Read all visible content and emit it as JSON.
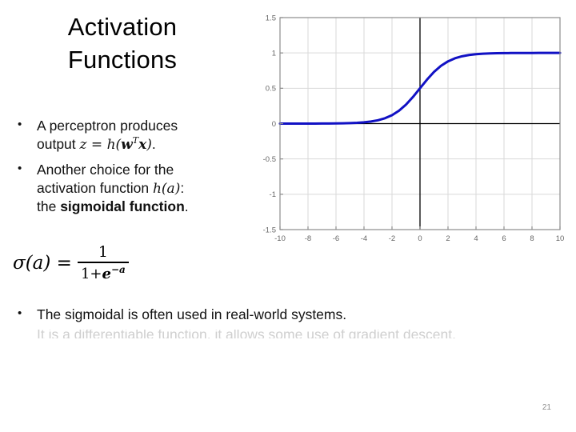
{
  "slide": {
    "title": "Activation\nFunctions",
    "page_number": "21",
    "bullet_glyph": "•"
  },
  "bullets": [
    {
      "line1_prefix": " A perceptron produces",
      "line2_prefix": "output ",
      "math_z": "z",
      "math_eq": " = ",
      "math_h": "h",
      "math_open": "(",
      "math_w": "w",
      "math_sup_T": "T",
      "math_x": "x",
      "math_close": ")",
      "tail": "."
    },
    {
      "line1": "Another choice for the",
      "line2_prefix": "activation function ",
      "math_h": "h",
      "math_open": "(",
      "math_a": "a",
      "math_close": ")",
      "line2_tail": ":",
      "line3_prefix": "the ",
      "line3_bold": "sigmoidal function",
      "line3_tail": "."
    }
  ],
  "equation": {
    "lhs": "σ(a) =",
    "numerator": "1",
    "denominator_one": "1+",
    "denominator_e": "e",
    "denominator_exp": "−a"
  },
  "bottom_bullets": [
    {
      "text": "The sigmoidal is often used in real-world systems."
    }
  ],
  "clipped_line": {
    "text": "It is a differentiable function, it allows some use of gradient descent."
  },
  "chart_data": {
    "type": "line",
    "title": "",
    "xlabel": "",
    "ylabel": "",
    "xlim": [
      -10,
      10
    ],
    "ylim": [
      -1.5,
      1.5
    ],
    "grid": true,
    "legend": null,
    "x_ticks": [
      "-10",
      "-8",
      "-6",
      "-4",
      "-2",
      "0",
      "2",
      "4",
      "6",
      "8",
      "10"
    ],
    "y_ticks": [
      "1.5",
      "1",
      "0.5",
      "0",
      "-0.5",
      "-1",
      "-1.5"
    ],
    "x_tick_values": [
      -10,
      -8,
      -6,
      -4,
      -2,
      0,
      2,
      4,
      6,
      8,
      10
    ],
    "y_tick_values": [
      1.5,
      1,
      0.5,
      0,
      -0.5,
      -1,
      -1.5
    ],
    "zero_axis_color": "#000000",
    "grid_color": "#d9d9d9",
    "frame_color": "#8c8c8c",
    "tick_label_color": "#666666",
    "series": [
      {
        "name": "sigmoid",
        "color": "#1111c4",
        "linewidth": 3,
        "x": [
          -10,
          -9.5,
          -9,
          -8.5,
          -8,
          -7.5,
          -7,
          -6.5,
          -6,
          -5.5,
          -5,
          -4.5,
          -4,
          -3.5,
          -3,
          -2.5,
          -2,
          -1.5,
          -1,
          -0.5,
          0,
          0.5,
          1,
          1.5,
          2,
          2.5,
          3,
          3.5,
          4,
          4.5,
          5,
          5.5,
          6,
          6.5,
          7,
          7.5,
          8,
          8.5,
          9,
          9.5,
          10
        ],
        "y": [
          4.54e-05,
          7.49e-05,
          0.0001234,
          0.0002035,
          0.0003354,
          0.0005527,
          0.000911,
          0.0015011,
          0.0024726,
          0.0040701,
          0.0066929,
          0.0109869,
          0.0179862,
          0.0293122,
          0.0474259,
          0.0758582,
          0.1192029,
          0.1824255,
          0.2689414,
          0.3775407,
          0.5,
          0.6224593,
          0.7310586,
          0.8175745,
          0.8807971,
          0.9241418,
          0.9525741,
          0.9706877,
          0.9820138,
          0.9890131,
          0.9933071,
          0.9959299,
          0.9975274,
          0.9984989,
          0.999089,
          0.9994473,
          0.9996646,
          0.9997965,
          0.9998766,
          0.9999251,
          0.9999546
        ]
      }
    ]
  }
}
